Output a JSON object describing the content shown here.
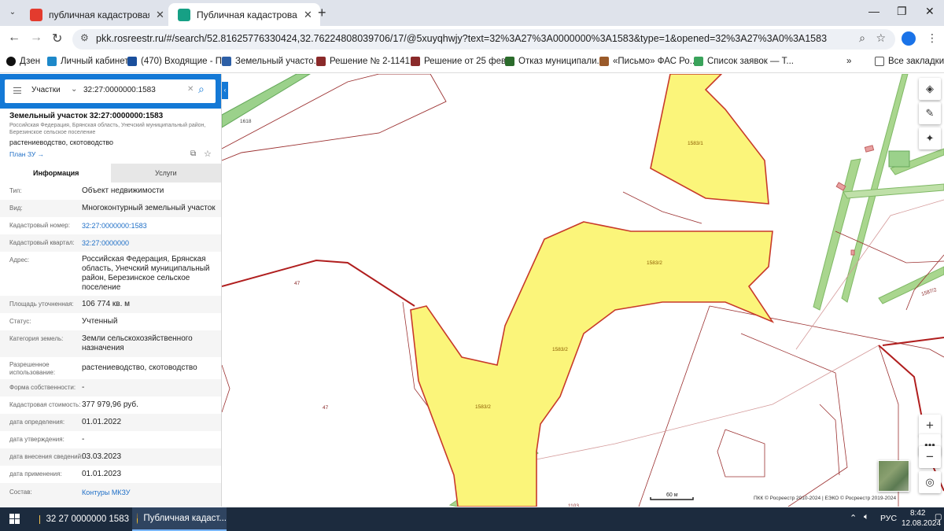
{
  "browser": {
    "tabs": [
      {
        "title": "публичная кадастровая карта",
        "favicon_color": "#e33b2e"
      },
      {
        "title": "Публичная кадастровая карт",
        "favicon_color": "#16a085"
      }
    ],
    "url": "pkk.rosreestr.ru/#/search/52.81625776330424,32.76224808039706/17/@5xuyqhwjy?text=32%3A27%3A0000000%3A1583&type=1&opened=32%3A27%3A0%3A1583",
    "bookmarks": [
      {
        "label": "Дзен",
        "color": "#111111"
      },
      {
        "label": "Личный кабинет",
        "color": "#1d88c9"
      },
      {
        "label": "(470) Входящие - П...",
        "color": "#1a4f9c"
      },
      {
        "label": "Земельный участо...",
        "color": "#2d5fa6"
      },
      {
        "label": "Решение № 2-1141...",
        "color": "#8a2a2a"
      },
      {
        "label": "Решение от 25 фев...",
        "color": "#8a2a2a"
      },
      {
        "label": "Отказ муниципали...",
        "color": "#2b6b2b"
      },
      {
        "label": "«Письмо» ФАС Ро...",
        "color": "#9a5a2a"
      },
      {
        "label": "Список заявок — Т...",
        "color": "#3aa35b"
      }
    ],
    "all_bookmarks_label": "Все закладки"
  },
  "panel": {
    "search_type": "Участки",
    "search_value": "32:27:0000000:1583",
    "title": "Земельный участок 32:27:0000000:1583",
    "subtitle": "Российская Федерация, Брянская область, Унечский муниципальный район, Березинское сельское поселение",
    "usage_short": "растениеводство, скотоводство",
    "plan_link": "План ЗУ →",
    "tabs": {
      "info": "Информация",
      "services": "Услуги"
    },
    "fields": [
      {
        "label": "Тип:",
        "value": "Объект недвижимости"
      },
      {
        "label": "Вид:",
        "value": "Многоконтурный земельный участок"
      },
      {
        "label": "Кадастровый номер:",
        "value": "32:27:0000000:1583",
        "link": true
      },
      {
        "label": "Кадастровый квартал:",
        "value": "32:27:0000000",
        "link": true
      },
      {
        "label": "Адрес:",
        "value": "Российская Федерация, Брянская область, Унечский муниципальный район, Березинское сельское поселение"
      },
      {
        "label": "Площадь уточненная:",
        "value": "106 774 кв. м"
      },
      {
        "label": "Статус:",
        "value": "Учтенный"
      },
      {
        "label": "Категория земель:",
        "value": "Земли сельскохозяйственного назначения"
      },
      {
        "label": "Разрешенное использование:",
        "value": "растениеводство, скотоводство"
      },
      {
        "label": "Форма собственности:",
        "value": "-"
      },
      {
        "label": "Кадастровая стоимость:",
        "value": "377 979,96 руб."
      },
      {
        "label": "дата определения:",
        "value": "01.01.2022"
      },
      {
        "label": "дата утверждения:",
        "value": "-"
      },
      {
        "label": "дата внесения сведений:",
        "value": "03.03.2023"
      },
      {
        "label": "дата применения:",
        "value": "01.01.2023"
      },
      {
        "label": "Состав:",
        "value": "Контуры МКЗУ",
        "link": true
      }
    ]
  },
  "map": {
    "labels": {
      "c1": "1583/1",
      "c2a": "1583/2",
      "c2b": "1583/2",
      "c2c": "1583/2",
      "p47a": "47",
      "p47b": "47",
      "p1618": "1618",
      "p1587": "1587/2",
      "p1103": "1103"
    },
    "scale_label": "60 м",
    "copyright": "ПКК © Росреестр 2010-2024 | ЕЭКО © Росреестр 2019-2024"
  },
  "taskbar": {
    "folder_title": "32 27 0000000 1583",
    "browser_title": "Публичная кадаст...",
    "lang": "РУС",
    "time": "8:42",
    "date": "12.08.2024"
  }
}
